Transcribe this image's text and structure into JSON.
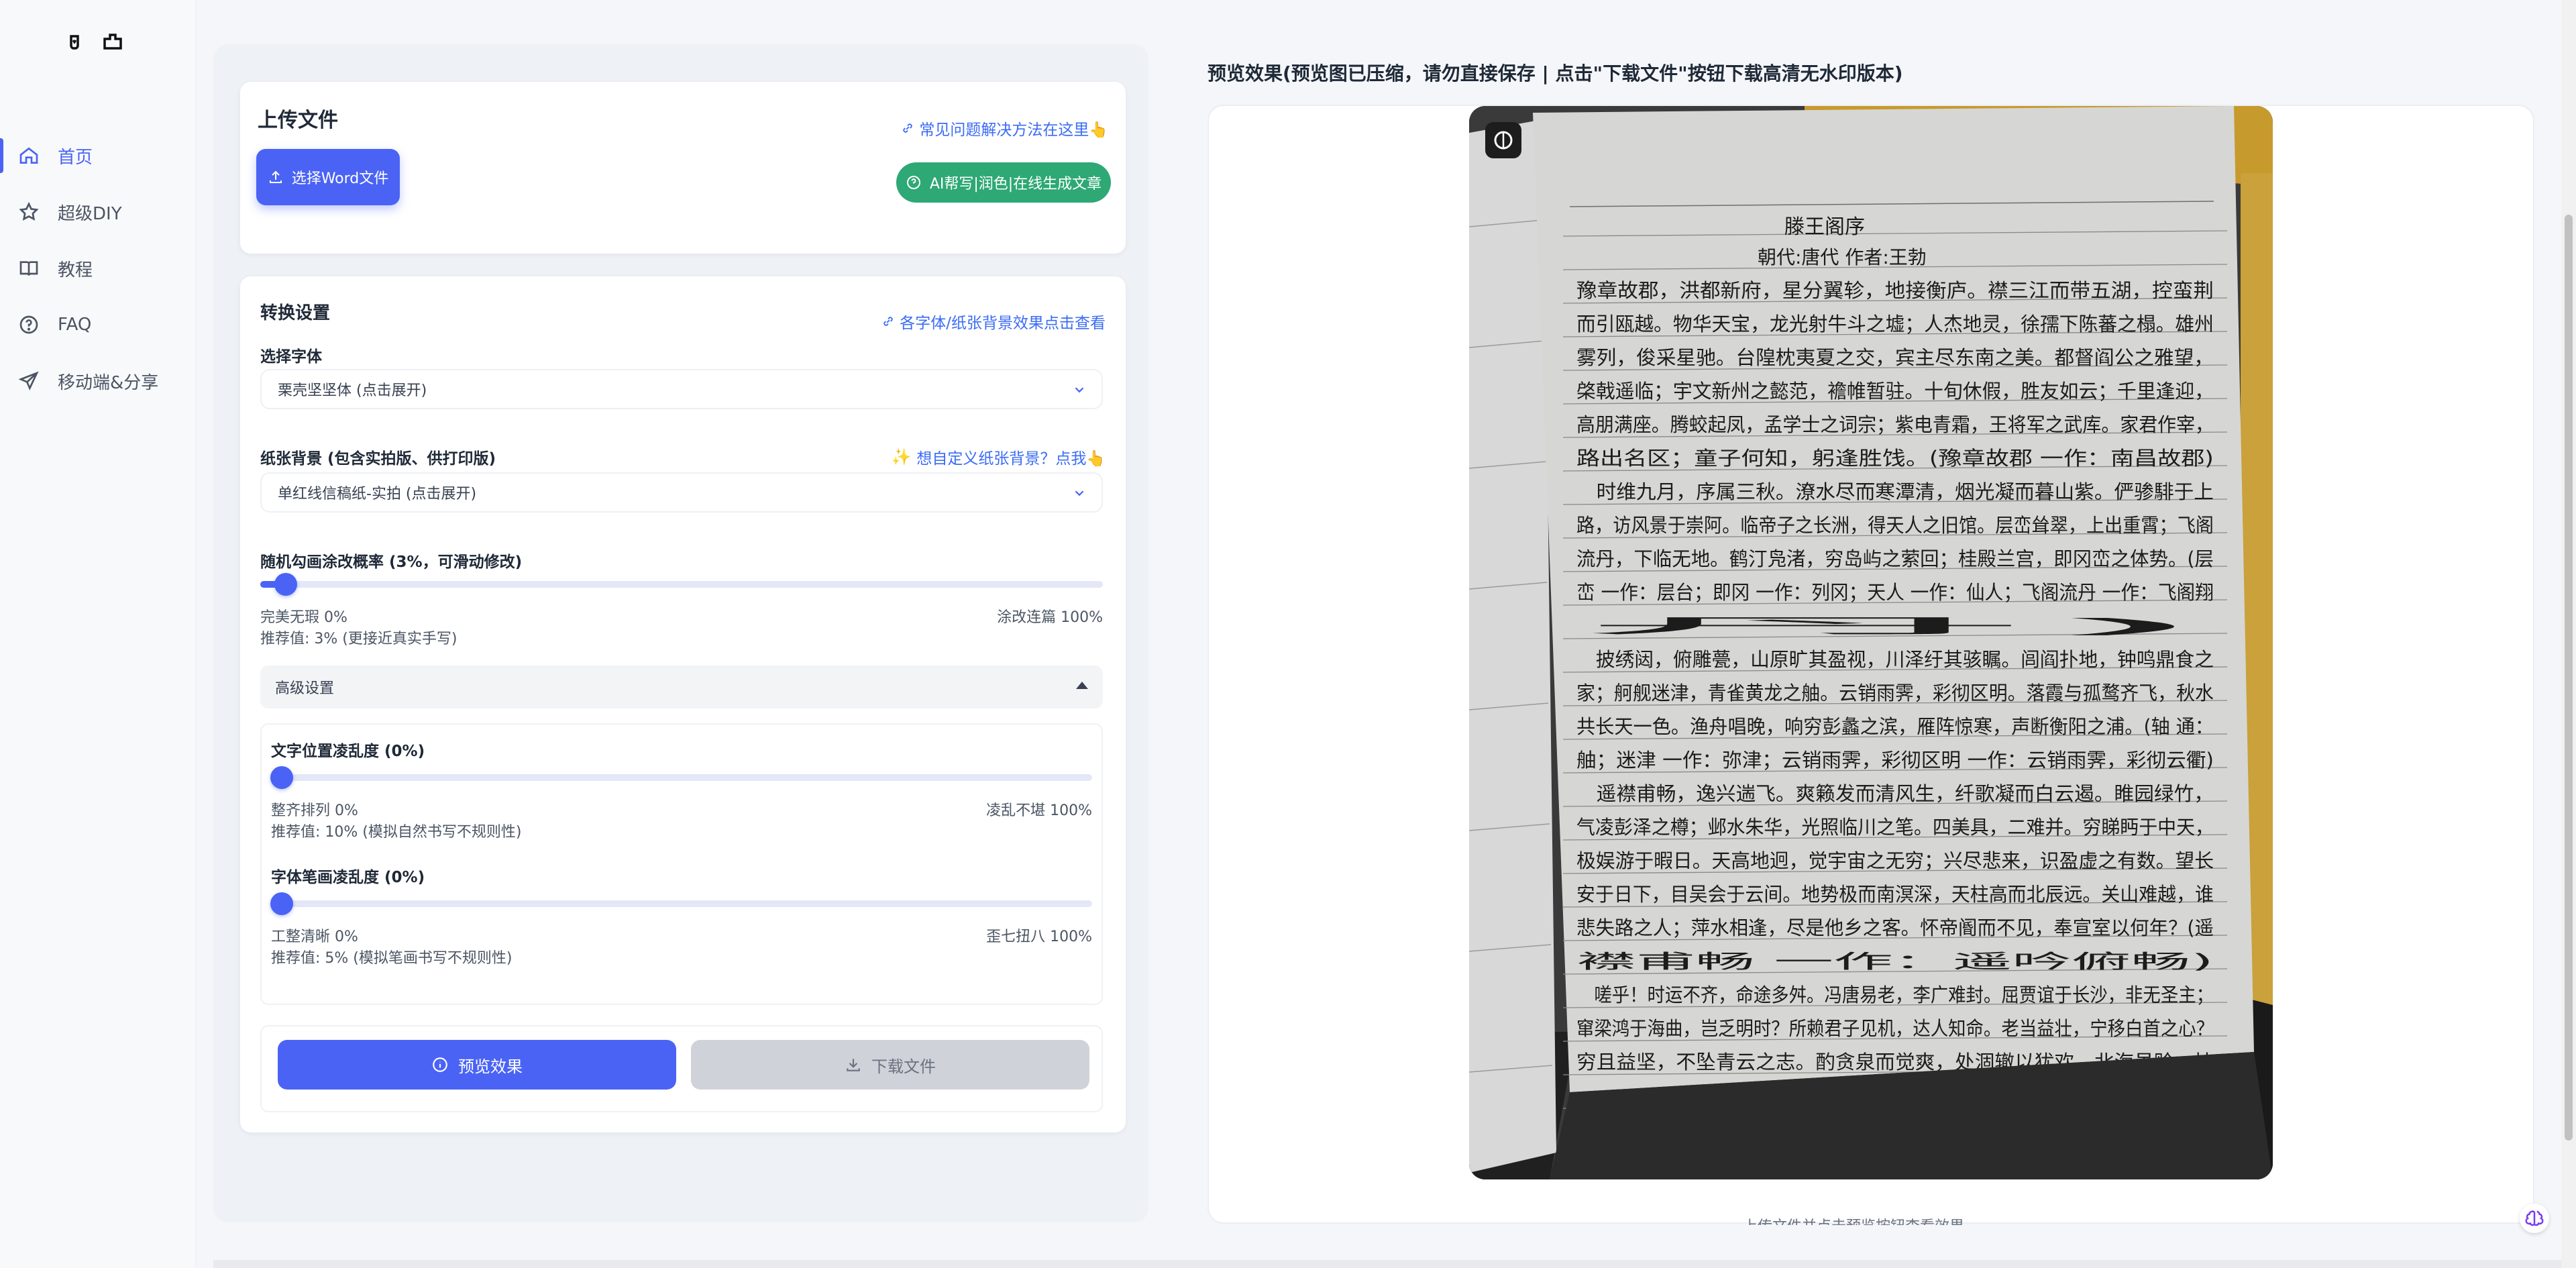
{
  "sidebar": {
    "items": [
      {
        "label": "首页",
        "icon": "home-icon",
        "active": true
      },
      {
        "label": "超级DIY",
        "icon": "star-icon",
        "active": false
      },
      {
        "label": "教程",
        "icon": "book-icon",
        "active": false
      },
      {
        "label": "FAQ",
        "icon": "question-icon",
        "active": false
      },
      {
        "label": "移动端&分享",
        "icon": "send-icon",
        "active": false
      }
    ]
  },
  "upload": {
    "title": "上传文件",
    "faq_link": "常见问题解决方法在这里👆",
    "select_button": "选择Word文件",
    "ai_button": "AI帮写|润色|在线生成文章"
  },
  "settings": {
    "title": "转换设置",
    "font_preview_link": "各字体/纸张背景效果点击查看",
    "font_label": "选择字体",
    "font_value": "栗壳坚坚体 (点击展开)",
    "paper_label": "纸张背景 (包含实拍版、供打印版)",
    "paper_custom_link": "想自定义纸张背景？点我👆",
    "paper_value": "单红线信稿纸-实拍 (点击展开)",
    "scribble_label": "随机勾画涂改概率 (3%，可滑动修改)",
    "scribble_value": 3,
    "scribble_min": "完美无瑕 0%",
    "scribble_max": "涂改连篇 100%",
    "scribble_recommend": "推荐值: 3% (更接近真实手写)",
    "advanced_label": "高级设置",
    "position_label": "文字位置凌乱度 (0%)",
    "position_value": 0,
    "position_min": "整齐排列 0%",
    "position_max": "凌乱不堪 100%",
    "position_recommend": "推荐值: 10% (模拟自然书写不规则性)",
    "stroke_label": "字体笔画凌乱度 (0%)",
    "stroke_value": 0,
    "stroke_min": "工整清晰 0%",
    "stroke_max": "歪七扭八 100%",
    "stroke_recommend": "推荐值: 5% (模拟笔画书写不规则性)",
    "preview_button": "预览效果",
    "download_button": "下载文件"
  },
  "preview": {
    "title": "预览效果(预览图已压缩，请勿直接保存 | 点击\"下载文件\"按钮下载高清无水印版本)",
    "doc_title": "滕王阁序",
    "doc_subtitle": "朝代:唐代 作者:王勃",
    "lines": [
      "豫章故郡，洪都新府，星分翼轸，地接衡庐。襟三江而带五湖，控蛮荆",
      "而引瓯越。物华天宝，龙光射牛斗之墟；人杰地灵，徐孺下陈蕃之榻。雄州",
      "雾列，俊采星驰。台隍枕夷夏之交，宾主尽东南之美。都督阎公之雅望，",
      "棨戟遥临；宇文新州之懿范，襜帷暂驻。十旬休假，胜友如云；千里逢迎，",
      "高朋满座。腾蛟起凤，孟学士之词宗；紫电青霜，王将军之武库。家君作宰，",
      "路出名区；童子何知，躬逢胜饯。(豫章故郡 一作：南昌故郡)",
      "　时维九月，序属三秋。潦水尽而寒潭清，烟光凝而暮山紫。俨骖騑于上",
      "路，访风景于崇阿。临帝子之长洲，得天人之旧馆。层峦耸翠，上出重霄；飞阁",
      "流丹，下临无地。鹤汀凫渚，穷岛屿之萦回；桂殿兰宫，即冈峦之体势。(层",
      "峦 一作：层台；即冈 一作：列冈；天人 一作：仙人；飞阁流丹 一作：飞阁翔",
      "丹)",
      "　披绣闼，俯雕甍，山原旷其盈视，川泽纡其骇瞩。闾阎扑地，钟鸣鼎食之",
      "家；舸舰迷津，青雀黄龙之舳。云销雨霁，彩彻区明。落霞与孤鹜齐飞，秋水",
      "共长天一色。渔舟唱晚，响穷彭蠡之滨，雁阵惊寒，声断衡阳之浦。(轴 通：",
      "舳；迷津 一作：弥津；云销雨霁，彩彻区明 一作：云销雨霁，彩彻云衢)",
      "　遥襟甫畅，逸兴遄飞。爽籁发而清风生，纤歌凝而白云遏。睢园绿竹，",
      "气凌彭泽之樽；邺水朱华，光照临川之笔。四美具，二难并。穷睇眄于中天，",
      "极娱游于暇日。天高地迥，觉宇宙之无穷；兴尽悲来，识盈虚之有数。望长",
      "安于日下，目吴会于云间。地势极而南溟深，天柱高而北辰远。关山难越，谁",
      "悲失路之人；萍水相逢，尽是他乡之客。怀帝阍而不见，奉宣室以何年？(遥",
      "襟甫畅 一作：遥吟俯畅)",
      "　嗟乎！时运不齐，命途多舛。冯唐易老，李广难封。屈贾谊于长沙，非无圣主；",
      "窜梁鸿于海曲，岂乏明时？所赖君子见机，达人知命。老当益壮，宁移白首之心？",
      "穷且益坚，不坠青云之志。酌贪泉而觉爽，处涸辙以犹欢。北海虽赊，扶"
    ]
  },
  "bottom_hint": "上传文件并点击预览按钮查看效果"
}
